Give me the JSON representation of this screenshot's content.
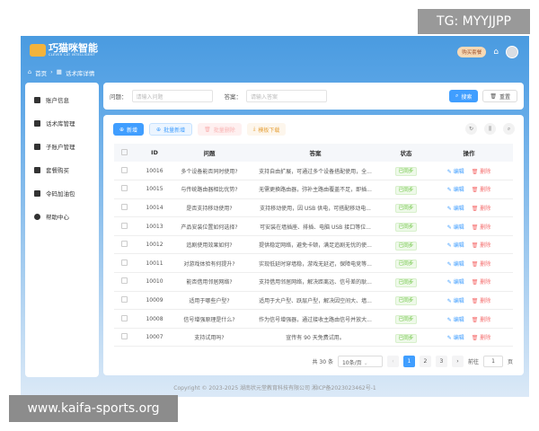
{
  "watermarks": {
    "top": "TG: MYYJJPP",
    "bottom": "www.kaifa-sports.org"
  },
  "header": {
    "logo_title": "巧猫咪智能",
    "logo_sub": "CLEVER CAT INTELLIGENT",
    "buy": "购买套餐",
    "breadcrumb": [
      "首页",
      "话术库详情"
    ]
  },
  "sidebar": {
    "items": [
      {
        "label": "账户信息"
      },
      {
        "label": "话术库管理"
      },
      {
        "label": "子账户管理"
      },
      {
        "label": "套餐购买"
      },
      {
        "label": "令码加油包"
      },
      {
        "label": "帮助中心"
      }
    ]
  },
  "search": {
    "q_label": "问题：",
    "q_placeholder": "请输入问题",
    "a_label": "答案：",
    "a_placeholder": "请输入答案",
    "search": "搜索",
    "reset": "重置"
  },
  "toolbar": {
    "add": "新增",
    "batch_add": "批量新增",
    "batch_delete": "批量删除",
    "template": "模板下载"
  },
  "table": {
    "headers": [
      "ID",
      "问题",
      "答案",
      "状态",
      "操作"
    ],
    "edit": "编辑",
    "delete": "删除",
    "rows": [
      {
        "id": "10016",
        "q": "多个设备能否同时使用?",
        "a": "支持自由扩展，可通过多个设备搭配使用，全...",
        "s": "已同步"
      },
      {
        "id": "10015",
        "q": "与传统路由器相比优势?",
        "a": "无需更换路由器，弥补主路由覆盖不足，即插...",
        "s": "已同步"
      },
      {
        "id": "10014",
        "q": "是否支持移动使用?",
        "a": "支持移动使用，因 USB 供电，可搭配移动电...",
        "s": "已同步"
      },
      {
        "id": "10013",
        "q": "产品安装位置如何选择?",
        "a": "可安装在墙插座、排插、电脑 USB 接口等位...",
        "s": "已同步"
      },
      {
        "id": "10012",
        "q": "追剧使用效果如何?",
        "a": "提供稳定网络，避免卡顿，满足追剧无忧的使...",
        "s": "已同步"
      },
      {
        "id": "10011",
        "q": "对游戏体验有何提升?",
        "a": "实现低延时穿墙稳，游戏无延迟，保障电竞等...",
        "s": "已同步"
      },
      {
        "id": "10010",
        "q": "能否借用邻居网络?",
        "a": "支持借用邻居网络，解决距离远、信号差的耿...",
        "s": "已同步"
      },
      {
        "id": "10009",
        "q": "适用于哪些户型?",
        "a": "适用于大户型、跃层户型，解决因空间大、墙...",
        "s": "已同步"
      },
      {
        "id": "10008",
        "q": "信号增强原理是什么?",
        "a": "作为信号增强器，通过接收主路由信号并放大...",
        "s": "已同步"
      },
      {
        "id": "10007",
        "q": "支持试用吗?",
        "a": "宣传有 90 天免费试用。",
        "s": "已同步"
      }
    ]
  },
  "pagination": {
    "total": "共 30 条",
    "size": "10条/页",
    "pages": [
      "1",
      "2",
      "3"
    ],
    "current": "1",
    "goto": "前往",
    "goto_value": "1",
    "unit": "页"
  },
  "footer": "Copyright © 2023-2025 湖南状元堂教育科技有限公司 湘ICP备2023023462号-1"
}
